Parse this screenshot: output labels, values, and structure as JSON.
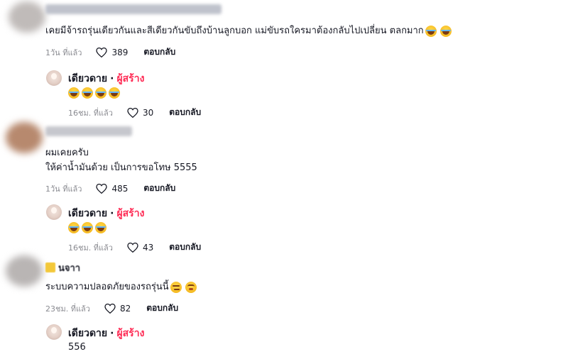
{
  "comments": [
    {
      "text": "เคยมีจ้ารถรุ่นเดียวกันและสีเดียวกันขับถึงบ้านลูกบอก แม่ขับรถใครมาต้องกลับไปเปลี่ยน ตลกมาก",
      "time": "1วัน ที่แล้ว",
      "likes": "389",
      "reply_label": "ตอบกลับ",
      "emojis": [
        "tears-of-joy-emoji",
        "tears-of-joy-emoji"
      ],
      "reply": {
        "author": "เดียวดาย",
        "dot": "·",
        "creator_label": "ผู้สร้าง",
        "emojis": [
          "tears-of-joy-emoji",
          "tears-of-joy-emoji",
          "tears-of-joy-emoji",
          "tears-of-joy-emoji"
        ],
        "time": "16ชม. ที่แล้ว",
        "likes": "30",
        "reply_label": "ตอบกลับ"
      }
    },
    {
      "text_line1": "ผมเคยครับ",
      "text_line2": "ให้ค่าน้ำมันด้วย เป็นการขอโทษ 5555",
      "time": "1วัน ที่แล้ว",
      "likes": "485",
      "reply_label": "ตอบกลับ",
      "reply": {
        "author": "เดียวดาย",
        "dot": "·",
        "creator_label": "ผู้สร้าง",
        "emojis": [
          "tears-of-joy-emoji",
          "tears-of-joy-emoji",
          "tears-of-joy-emoji"
        ],
        "time": "16ชม. ที่แล้ว",
        "likes": "43",
        "reply_label": "ตอบกลับ"
      }
    },
    {
      "name_partial": "นจาา",
      "text": "ระบบความปลอดภัยของรถรุ่นนี้",
      "emojis": [
        "smirking-emoji",
        "flushed-emoji"
      ],
      "time": "23ชม. ที่แล้ว",
      "likes": "82",
      "reply_label": "ตอบกลับ",
      "reply": {
        "author": "เดียวดาย",
        "dot": "·",
        "creator_label": "ผู้สร้าง",
        "text": "556"
      }
    }
  ],
  "colors": {
    "creator": "#fe2c55",
    "meta": "#8a8b91",
    "text": "#161823"
  }
}
